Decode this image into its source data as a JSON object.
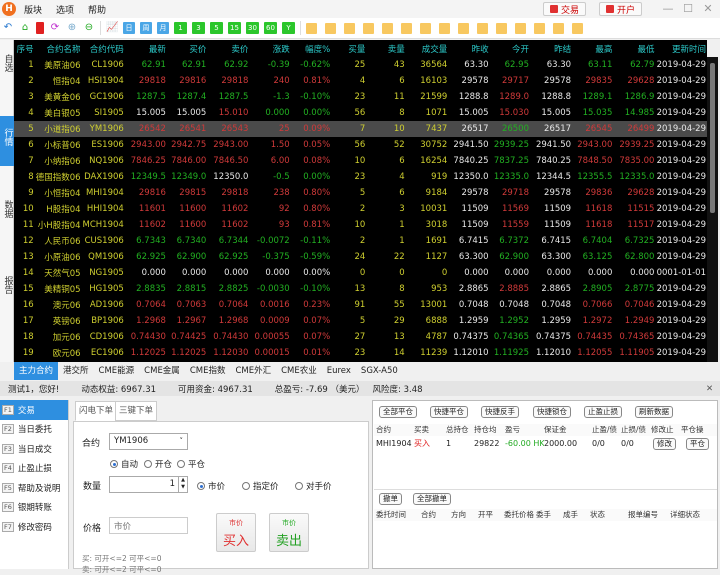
{
  "menu": {
    "logo": "H",
    "items": [
      "版块",
      "选项",
      "帮助"
    ],
    "trade_btn": "交易",
    "open_account_btn": "开户",
    "win": [
      "—",
      "☐",
      "✕"
    ]
  },
  "toolbar": {
    "icons": [
      "home-icon",
      "bookmark-icon",
      "refresh-icon",
      "zoom-in-icon",
      "zoom-out-icon",
      "chart-icon"
    ],
    "period_labels": [
      "日",
      "周",
      "月"
    ],
    "minute_labels": [
      "1",
      "3",
      "5",
      "15",
      "30",
      "60",
      "Y"
    ],
    "draw_tools": [
      "text-tool",
      "line-tool",
      "segment-tool",
      "hline-tool",
      "vline-tool",
      "wave-tool",
      "channel-tool",
      "parallel-tool",
      "fib-tool",
      "box-tool",
      "up-arrow-tool",
      "down-arrow-tool",
      "cloud-tool",
      "eye-tool",
      "delete-tool"
    ]
  },
  "sidebar": {
    "tabs": [
      "自选",
      "行情",
      "数据",
      "报告"
    ],
    "active": "行情"
  },
  "quote": {
    "headers": [
      "序号",
      "合约名称",
      "合约代码",
      "最新",
      "买价",
      "卖价",
      "涨跌",
      "幅度%",
      "买量",
      "卖量",
      "成交量",
      "昨收",
      "今开",
      "昨结",
      "最高",
      "最低",
      "更新时间"
    ],
    "selected_row": 5,
    "colors": {
      "y": "#cfcf30",
      "g": "#22b022",
      "r": "#d03a3a",
      "w": "#e8e8e8",
      "header": "#2ccaca"
    },
    "rows": [
      {
        "c": "yyygggggyyywgwggw",
        "v": [
          "1",
          "美原油06",
          "CL1906",
          "62.91",
          "62.91",
          "62.92",
          "-0.39",
          "-0.62%",
          "25",
          "43",
          "36564",
          "63.30",
          "62.95",
          "63.30",
          "63.11",
          "62.79",
          "2019-04-29"
        ]
      },
      {
        "c": "yyyrrrrryyywrwrrw",
        "v": [
          "2",
          "恒指04",
          "HSI1904",
          "29818",
          "29816",
          "29818",
          "240",
          "0.81%",
          "4",
          "6",
          "16103",
          "29578",
          "29717",
          "29578",
          "29835",
          "29628",
          "2019-04-29"
        ]
      },
      {
        "c": "yyygggggyyywrwggw",
        "v": [
          "3",
          "美黄金06",
          "GC1906",
          "1287.5",
          "1287.4",
          "1287.5",
          "-1.3",
          "-0.10%",
          "23",
          "11",
          "21599",
          "1288.8",
          "1289.0",
          "1288.8",
          "1289.1",
          "1286.9",
          "2019-04-29"
        ]
      },
      {
        "c": "yyywwrggyyywrwggw",
        "v": [
          "4",
          "美白银05",
          "SI1905",
          "15.005",
          "15.005",
          "15.010",
          "0.000",
          "0.00%",
          "56",
          "8",
          "1071",
          "15.005",
          "15.030",
          "15.005",
          "15.035",
          "14.985",
          "2019-04-29"
        ]
      },
      {
        "c": "yyyrrrrryyywgwrrw",
        "v": [
          "5",
          "小道指06",
          "YM1906",
          "26542",
          "26541",
          "26543",
          "25",
          "0.09%",
          "7",
          "10",
          "7437",
          "26517",
          "26500",
          "26517",
          "26545",
          "26499",
          "2019-04-29"
        ]
      },
      {
        "c": "yyyrrrrryyywgwrrw",
        "v": [
          "6",
          "小标普06",
          "ES1906",
          "2943.00",
          "2942.75",
          "2943.00",
          "1.50",
          "0.05%",
          "56",
          "52",
          "30752",
          "2941.50",
          "2939.25",
          "2941.50",
          "2943.00",
          "2939.25",
          "2019-04-29"
        ]
      },
      {
        "c": "yyyrrrrryyywgwrrw",
        "v": [
          "7",
          "小纳指06",
          "NQ1906",
          "7846.25",
          "7846.00",
          "7846.50",
          "6.00",
          "0.08%",
          "10",
          "6",
          "16254",
          "7840.25",
          "7837.25",
          "7840.25",
          "7848.50",
          "7835.00",
          "2019-04-29"
        ]
      },
      {
        "c": "yyyggwggyyywgwggw",
        "v": [
          "8",
          "德国指数06",
          "DAX1906",
          "12349.5",
          "12349.0",
          "12350.0",
          "-0.5",
          "0.00%",
          "23",
          "4",
          "919",
          "12350.0",
          "12335.0",
          "12344.5",
          "12355.5",
          "12335.0",
          "2019-04-29"
        ]
      },
      {
        "c": "yyyrrrrryyywrwrrw",
        "v": [
          "9",
          "小恒指04",
          "MHI1904",
          "29816",
          "29815",
          "29818",
          "238",
          "0.80%",
          "5",
          "6",
          "9184",
          "29578",
          "29718",
          "29578",
          "29836",
          "29628",
          "2019-04-29"
        ]
      },
      {
        "c": "yyyrrrrryyywrwrrw",
        "v": [
          "10",
          "H股指04",
          "HHI1904",
          "11601",
          "11600",
          "11602",
          "92",
          "0.80%",
          "2",
          "3",
          "10031",
          "11509",
          "11569",
          "11509",
          "11618",
          "11515",
          "2019-04-29"
        ]
      },
      {
        "c": "yyyrrrrryyywrwrrw",
        "v": [
          "11",
          "小H股指04",
          "MCH1904",
          "11602",
          "11600",
          "11602",
          "93",
          "0.81%",
          "10",
          "1",
          "3018",
          "11509",
          "11559",
          "11509",
          "11618",
          "11517",
          "2019-04-29"
        ]
      },
      {
        "c": "yyygggggyyywgwggw",
        "v": [
          "12",
          "人民币06",
          "CUS1906",
          "6.7343",
          "6.7340",
          "6.7344",
          "-0.0072",
          "-0.11%",
          "2",
          "1",
          "1691",
          "6.7415",
          "6.7372",
          "6.7415",
          "6.7404",
          "6.7325",
          "2019-04-29"
        ]
      },
      {
        "c": "yyygggggyyywgwggw",
        "v": [
          "13",
          "小原油06",
          "QM1906",
          "62.925",
          "62.900",
          "62.925",
          "-0.375",
          "-0.59%",
          "24",
          "22",
          "1127",
          "63.300",
          "62.900",
          "63.300",
          "63.125",
          "62.800",
          "2019-04-29"
        ]
      },
      {
        "c": "yyywwwwwyyywwwwww",
        "v": [
          "14",
          "天然气05",
          "NG1905",
          "0.000",
          "0.000",
          "0.000",
          "0.000",
          "0.00%",
          "0",
          "0",
          "0",
          "0.000",
          "0.000",
          "0.000",
          "0.000",
          "0.000",
          "0001-01-01"
        ]
      },
      {
        "c": "yyygggggyyywrwggw",
        "v": [
          "15",
          "美精铜05",
          "HG1905",
          "2.8835",
          "2.8815",
          "2.8825",
          "-0.0030",
          "-0.10%",
          "13",
          "8",
          "953",
          "2.8865",
          "2.8885",
          "2.8865",
          "2.8905",
          "2.8775",
          "2019-04-29"
        ]
      },
      {
        "c": "yyyrrrrryyywwwrrw",
        "v": [
          "16",
          "澳元06",
          "AD1906",
          "0.7064",
          "0.7063",
          "0.7064",
          "0.0016",
          "0.23%",
          "91",
          "55",
          "13001",
          "0.7048",
          "0.7048",
          "0.7048",
          "0.7066",
          "0.7046",
          "2019-04-29"
        ]
      },
      {
        "c": "yyyrrrrryyywgwrrw",
        "v": [
          "17",
          "英镑06",
          "BP1906",
          "1.2968",
          "1.2967",
          "1.2968",
          "0.0009",
          "0.07%",
          "5",
          "29",
          "6888",
          "1.2959",
          "1.2952",
          "1.2959",
          "1.2972",
          "1.2949",
          "2019-04-29"
        ]
      },
      {
        "c": "yyyrrrrryyywgwrrw",
        "v": [
          "18",
          "加元06",
          "CD1906",
          "0.74430",
          "0.74425",
          "0.74430",
          "0.00055",
          "0.07%",
          "27",
          "13",
          "4787",
          "0.74375",
          "0.74365",
          "0.74375",
          "0.74435",
          "0.74365",
          "2019-04-29"
        ]
      },
      {
        "c": "yyyrrrrryyywgwrrw",
        "v": [
          "19",
          "欧元06",
          "EC1906",
          "1.12025",
          "1.12025",
          "1.12030",
          "0.00015",
          "0.01%",
          "23",
          "14",
          "11239",
          "1.12010",
          "1.11925",
          "1.12010",
          "1.12055",
          "1.11905",
          "2019-04-29"
        ]
      }
    ]
  },
  "market_tabs": [
    "主力合约",
    "港交所",
    "CME能源",
    "CME金属",
    "CME指数",
    "CME外汇",
    "CME农业",
    "Eurex",
    "SGX-A50"
  ],
  "status": {
    "greeting": "测试1，您好!",
    "equity": "动态权益: 6967.31",
    "available": "可用资金: 4967.31",
    "pnl": "总盈亏: -7.69 （美元）",
    "risk": "风险度: 3.48",
    "close": "✕"
  },
  "fnav": [
    {
      "key": "F1",
      "label": "交易"
    },
    {
      "key": "F2",
      "label": "当日委托"
    },
    {
      "key": "F3",
      "label": "当日成交"
    },
    {
      "key": "F4",
      "label": "止盈止损"
    },
    {
      "key": "F5",
      "label": "帮助及说明"
    },
    {
      "key": "F6",
      "label": "银期转账"
    },
    {
      "key": "F7",
      "label": "修改密码"
    }
  ],
  "order": {
    "tabs": [
      "闪电下单",
      "三键下单"
    ],
    "contract_label": "合约",
    "contract_value": "YM1906",
    "open_close": [
      "自动",
      "开仓",
      "平仓"
    ],
    "qty_label": "数量",
    "qty_value": "1",
    "price_types": [
      "市价",
      "指定价",
      "对手价"
    ],
    "price_label": "价格",
    "price_placeholder": "市价",
    "buy_small": "市价",
    "buy_label": "买入",
    "sell_small": "市价",
    "sell_label": "卖出",
    "buy_info": "买: 可开<=2 可平<=0",
    "sell_info": "卖: 可开<=2 可平<=0"
  },
  "positions": {
    "buttons": [
      "全部平仓",
      "快捷平仓",
      "快捷反手",
      "快捷锁仓",
      "止盈止损",
      "刷新数据"
    ],
    "headers": [
      "合约",
      "买卖",
      "总持仓",
      "持仓均",
      "盈亏",
      "保证金",
      "止盈/债",
      "止损/债",
      "修改止",
      "平仓操"
    ],
    "row": {
      "contract": "MHI1904",
      "side": "买入",
      "total": "1",
      "avg": "29822",
      "pnl": "-60.00 HK",
      "margin": "2000.00",
      "tp": "0/0",
      "sl": "0/0",
      "modify": "修改",
      "close": "平仓"
    }
  },
  "orders": {
    "buttons": [
      "撤单",
      "全部撤单"
    ],
    "headers": [
      "委托时间",
      "合约",
      "方向",
      "开平",
      "委托价格",
      "委手",
      "成手",
      "状态",
      "报单编号",
      "详细状态"
    ]
  }
}
